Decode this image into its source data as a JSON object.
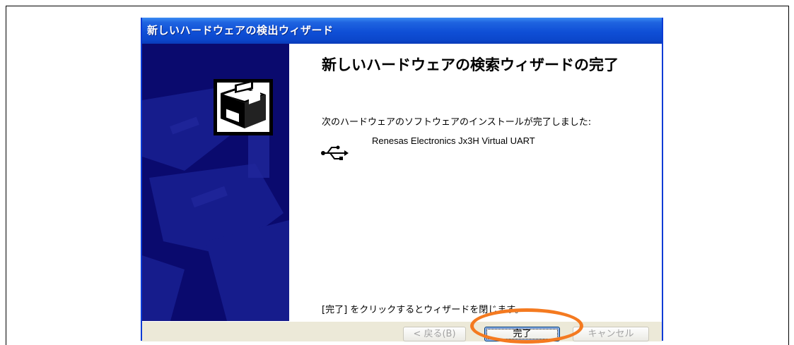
{
  "window": {
    "title": "新しいハードウェアの検出ウィザード"
  },
  "content": {
    "heading": "新しいハードウェアの検索ウィザードの完了",
    "description": "次のハードウェアのソフトウェアのインストールが完了しました:",
    "device_icon": "usb-icon",
    "device_name": "Renesas Electronics Jx3H Virtual UART",
    "closing_text": "[完了] をクリックするとウィザードを閉じます。"
  },
  "buttons": {
    "back_label": "< 戻る(B)",
    "finish_label": "完了",
    "cancel_label": "キャンセル"
  },
  "colors": {
    "titlebar": "#0b47cb",
    "sidepanel": "#0a0a6e",
    "highlight": "#f47a20",
    "footer": "#ece9d8"
  }
}
